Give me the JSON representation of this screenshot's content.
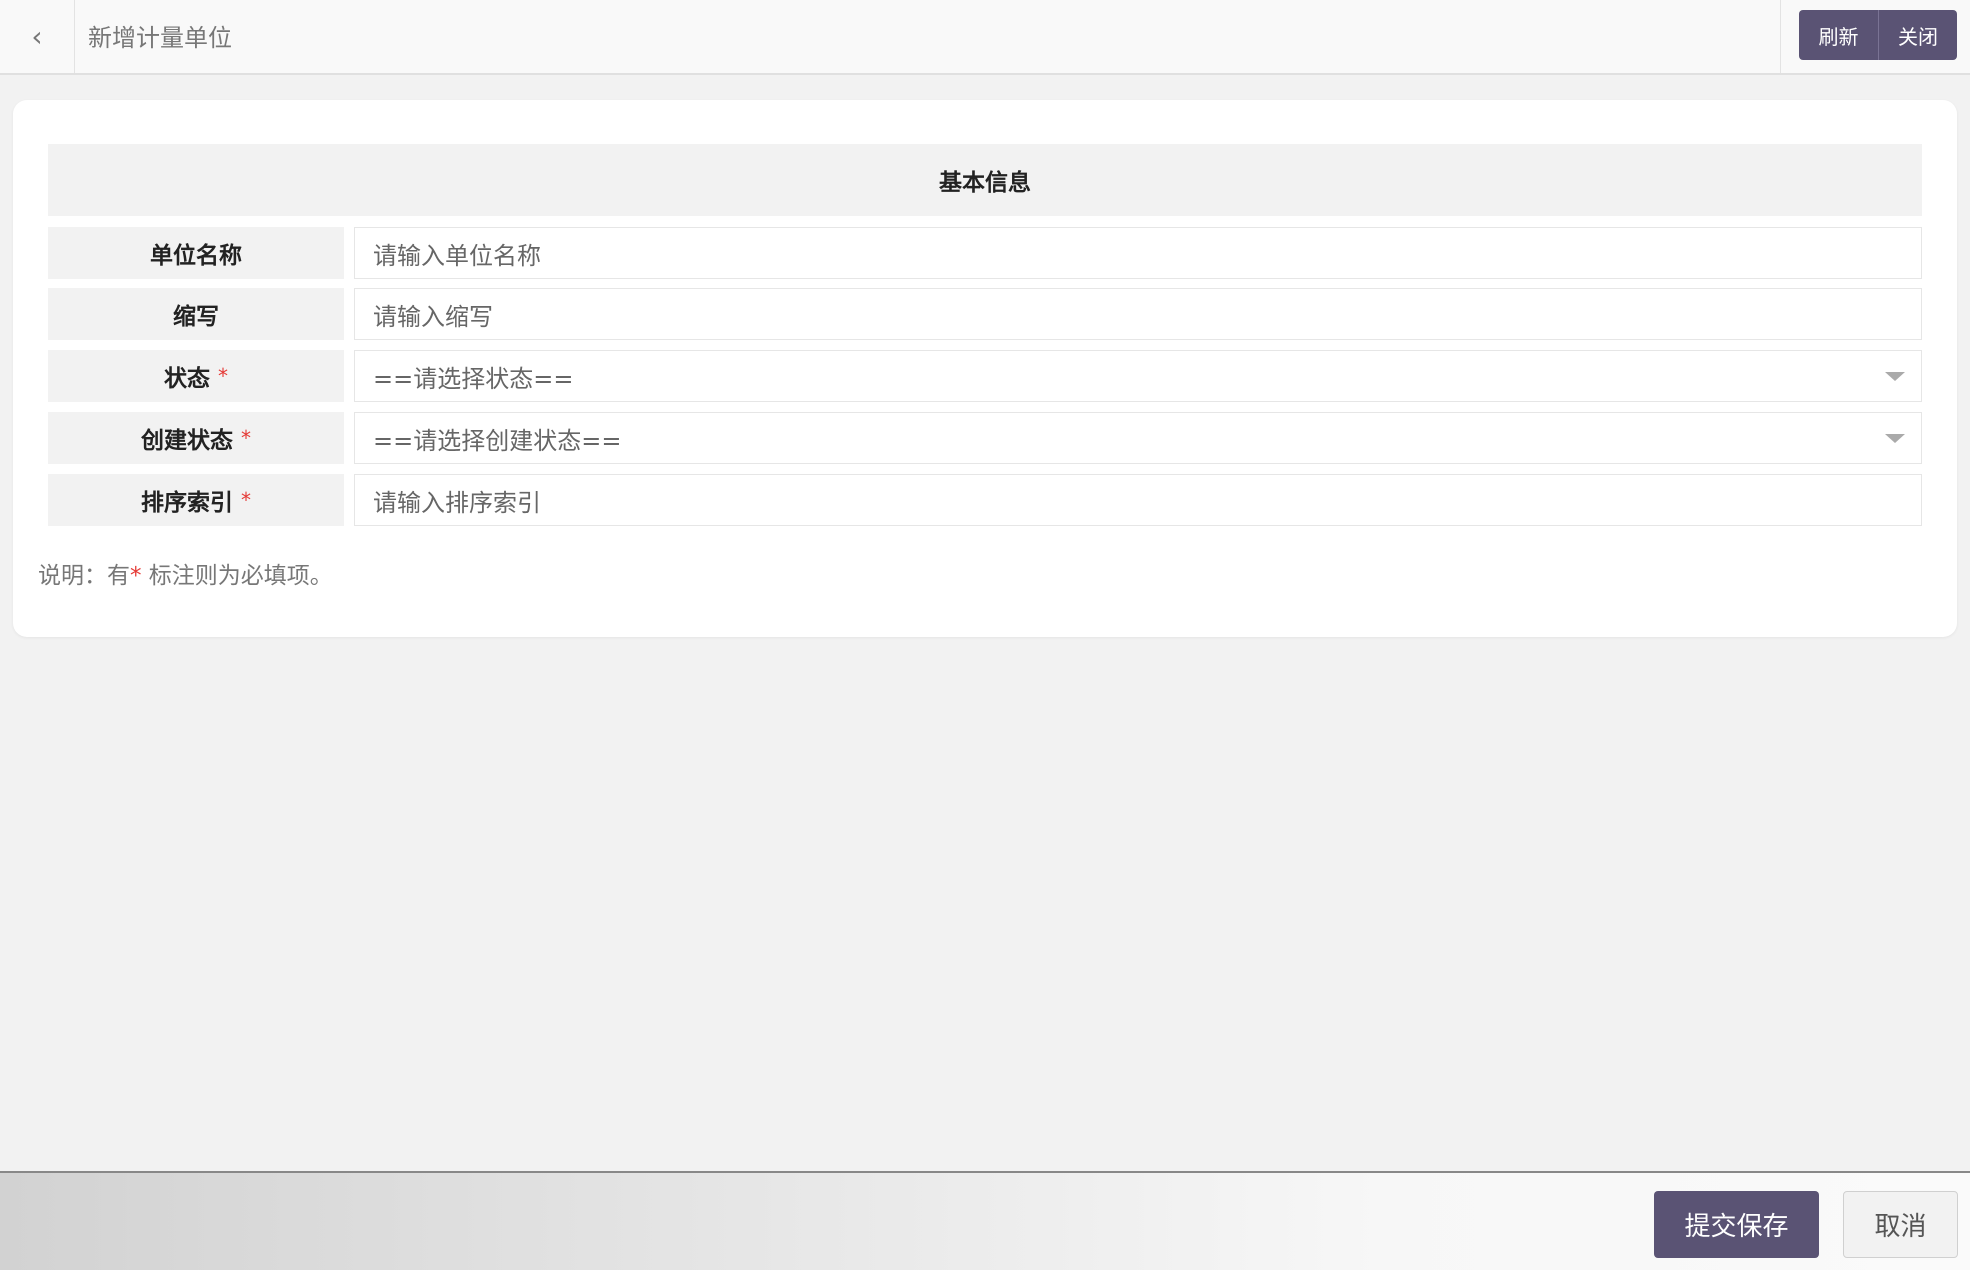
{
  "header": {
    "back_icon": "chevron-left-icon",
    "title": "新增计量单位",
    "refresh_label": "刷新",
    "close_label": "关闭"
  },
  "form": {
    "section_title": "基本信息",
    "fields": [
      {
        "label": "单位名称",
        "placeholder": "请输入单位名称",
        "required": false,
        "type": "text"
      },
      {
        "label": "缩写",
        "placeholder": "请输入缩写",
        "required": false,
        "type": "text"
      },
      {
        "label": "状态",
        "value": "==请选择状态==",
        "required": true,
        "type": "select"
      },
      {
        "label": "创建状态",
        "value": "==请选择创建状态==",
        "required": true,
        "type": "select"
      },
      {
        "label": "排序索引",
        "placeholder": "请输入排序索引",
        "required": true,
        "type": "text"
      }
    ],
    "required_mark": "*",
    "note_prefix": "说明：有",
    "note_suffix": " 标注则为必填项。"
  },
  "footer": {
    "submit_label": "提交保存",
    "cancel_label": "取消"
  },
  "colors": {
    "primary": "#5a5374",
    "required": "#e53935"
  }
}
